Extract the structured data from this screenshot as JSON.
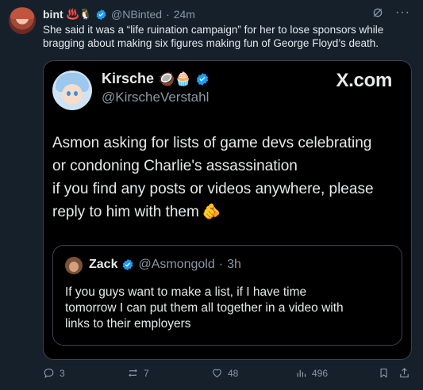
{
  "post": {
    "author_name": "bint",
    "author_emojis": "♨️🐧",
    "author_handle": "@NBinted",
    "separator": "·",
    "time": "24m",
    "text": "She said it was a “life ruination campaign” for her to lose sponsors while bragging about making six figures making fun of George Floyd’s death.",
    "icons": {
      "grok": "grok-icon",
      "more": "more-icon"
    }
  },
  "quote": {
    "name": "Kirsche",
    "name_emojis": "🥥🧁",
    "handle": "@KirscheVerstahl",
    "brand": "X.com",
    "text_lines": [
      "Asmon asking for lists of game devs celebrating",
      "or condoning Charlie's assassination",
      "if you find any posts or videos anywhere, please",
      "reply to him with them"
    ],
    "end_emoji": "🫵"
  },
  "inner_quote": {
    "name": "Zack",
    "handle": "@Asmongold",
    "separator": "·",
    "time": "3h",
    "text_lines": [
      "If you guys want to make a list, if I have time",
      "tomorrow I can put them all together in a video with",
      "links to their employers"
    ]
  },
  "actions": {
    "replies": "3",
    "reposts": "7",
    "likes": "48",
    "views": "496"
  },
  "colors": {
    "background": "#15202b",
    "card": "#000000",
    "verified": "#1d9bf0",
    "muted": "#8b98a5",
    "text": "#e7e9ea",
    "border": "#38444d"
  }
}
